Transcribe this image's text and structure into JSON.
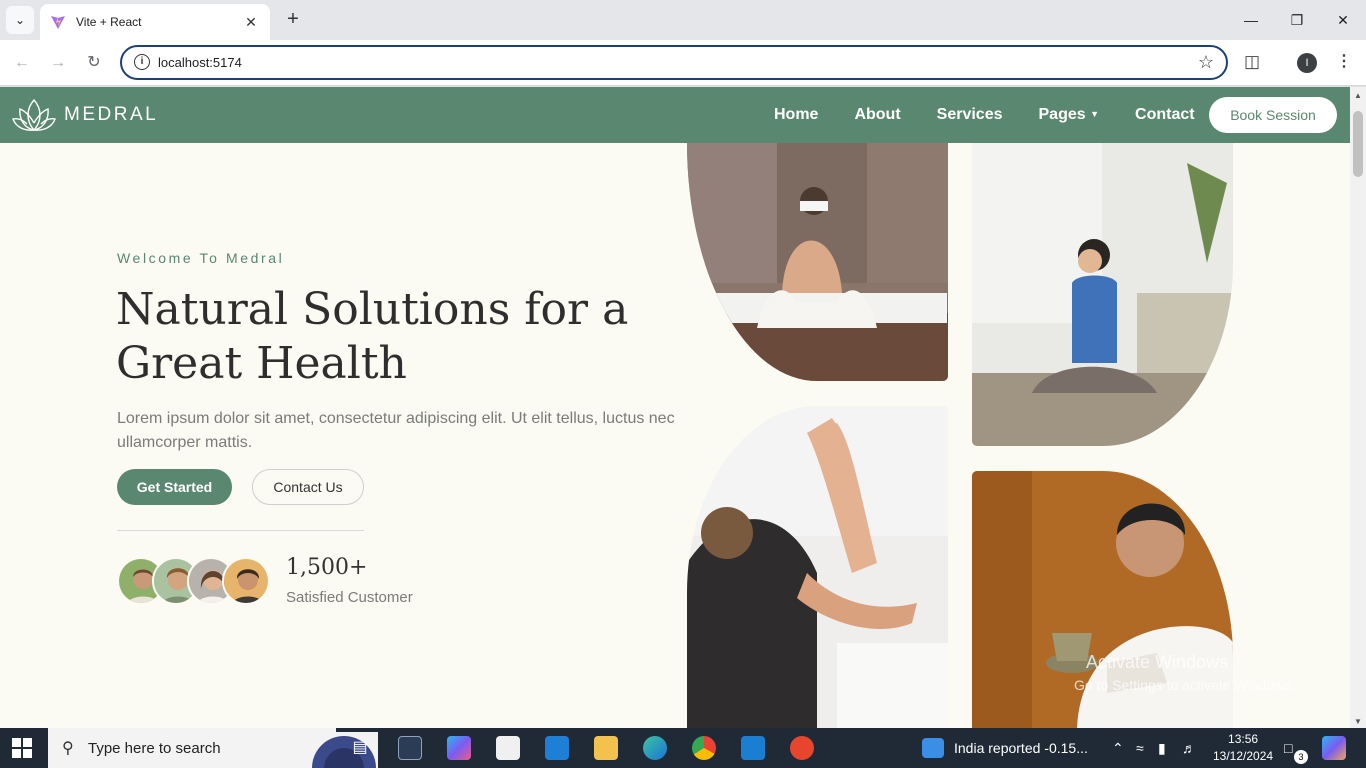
{
  "browser": {
    "tab_title": "Vite + React",
    "url": "localhost:5174"
  },
  "site": {
    "logo_text": "MEDRAL",
    "nav": [
      "Home",
      "About",
      "Services",
      "Pages",
      "Contact"
    ],
    "cta": "Book Session"
  },
  "hero": {
    "eyebrow": "Welcome To Medral",
    "title": "Natural Solutions for a Great Health",
    "description": "Lorem ipsum dolor sit amet, consectetur adipiscing elit. Ut elit tellus, luctus nec ullamcorper mattis.",
    "primary_button": "Get Started",
    "secondary_button": "Contact Us",
    "stat_number": "1,500+",
    "stat_label": "Satisfied Customer"
  },
  "watermark": {
    "line1": "Activate Windows",
    "line2": "Go to Settings to activate Windows."
  },
  "taskbar": {
    "search_placeholder": "Type here to search",
    "news": "India reported -0.15...",
    "time": "13:56",
    "date": "13/12/2024",
    "notification_count": "3"
  },
  "colors": {
    "brand_green": "#5a8770",
    "page_background": "#fbfaf3"
  }
}
